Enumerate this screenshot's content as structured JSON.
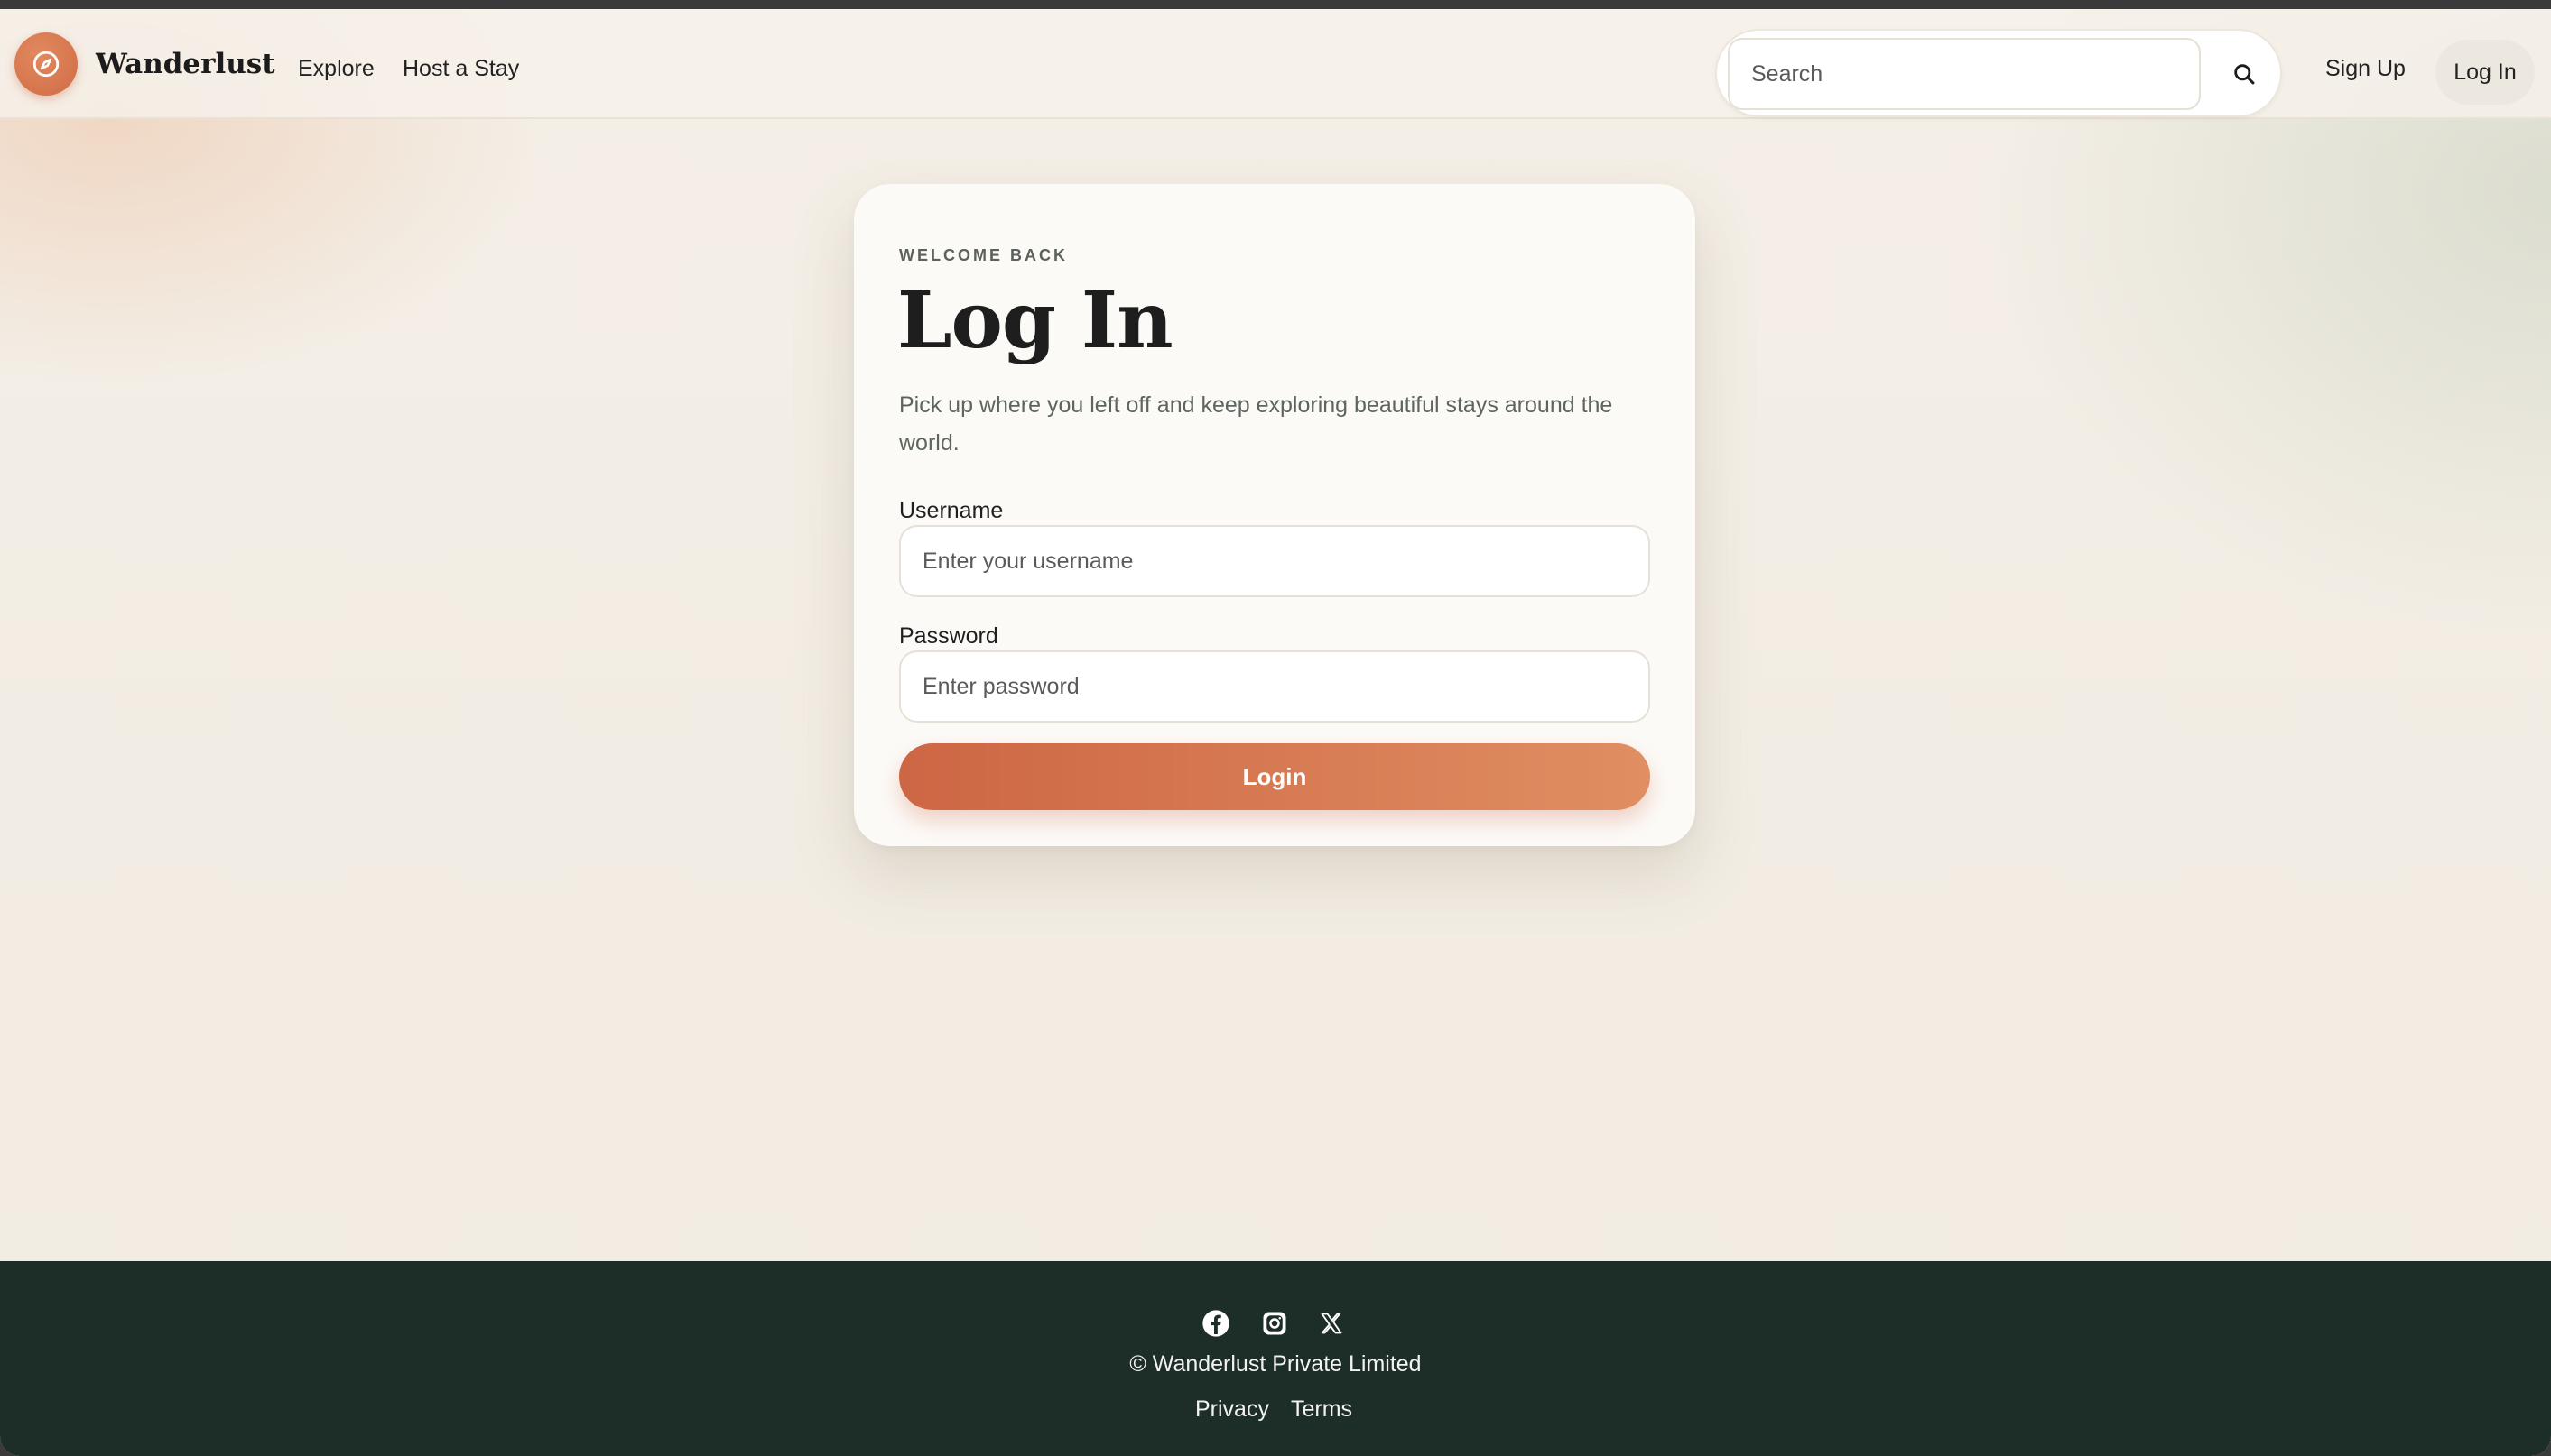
{
  "nav": {
    "brand": "Wanderlust",
    "links": [
      "Explore",
      "Host a Stay"
    ],
    "search_placeholder": "Search",
    "signup_label": "Sign Up",
    "login_label": "Log In"
  },
  "card": {
    "eyebrow": "WELCOME BACK",
    "title": "Log In",
    "subtitle": "Pick up where you left off and keep exploring beautiful stays around the world.",
    "username_label": "Username",
    "username_placeholder": "Enter your username",
    "password_label": "Password",
    "password_placeholder": "Enter password",
    "submit_label": "Login"
  },
  "footer": {
    "social_icons": [
      "facebook-icon",
      "instagram-icon",
      "x-icon"
    ],
    "copyright": "© Wanderlust Private Limited",
    "links": [
      "Privacy",
      "Terms"
    ]
  },
  "colors": {
    "accent": "#cd6644",
    "accent_light": "#e08e62",
    "footer_bg": "#1d2e29",
    "page_bg": "#f4efe7"
  }
}
